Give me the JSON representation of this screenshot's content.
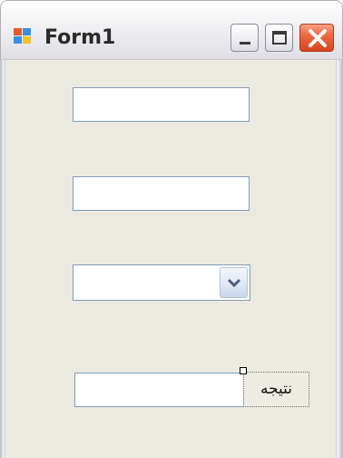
{
  "window": {
    "title": "Form1",
    "app_icon": "form-app-icon",
    "buttons": {
      "minimize_icon": "minimize-icon",
      "maximize_icon": "maximize-icon",
      "close_icon": "close-icon"
    }
  },
  "form": {
    "textbox1": {
      "value": ""
    },
    "textbox2": {
      "value": ""
    },
    "combobox": {
      "value": "",
      "arrow_icon": "chevron-down-icon"
    },
    "result_textbox": {
      "value": ""
    },
    "result_button": {
      "label": "نتیجه"
    }
  },
  "colors": {
    "close_button": "#D6471F",
    "control_border": "#7F9DB9",
    "form_background": "#ECE9E0"
  }
}
